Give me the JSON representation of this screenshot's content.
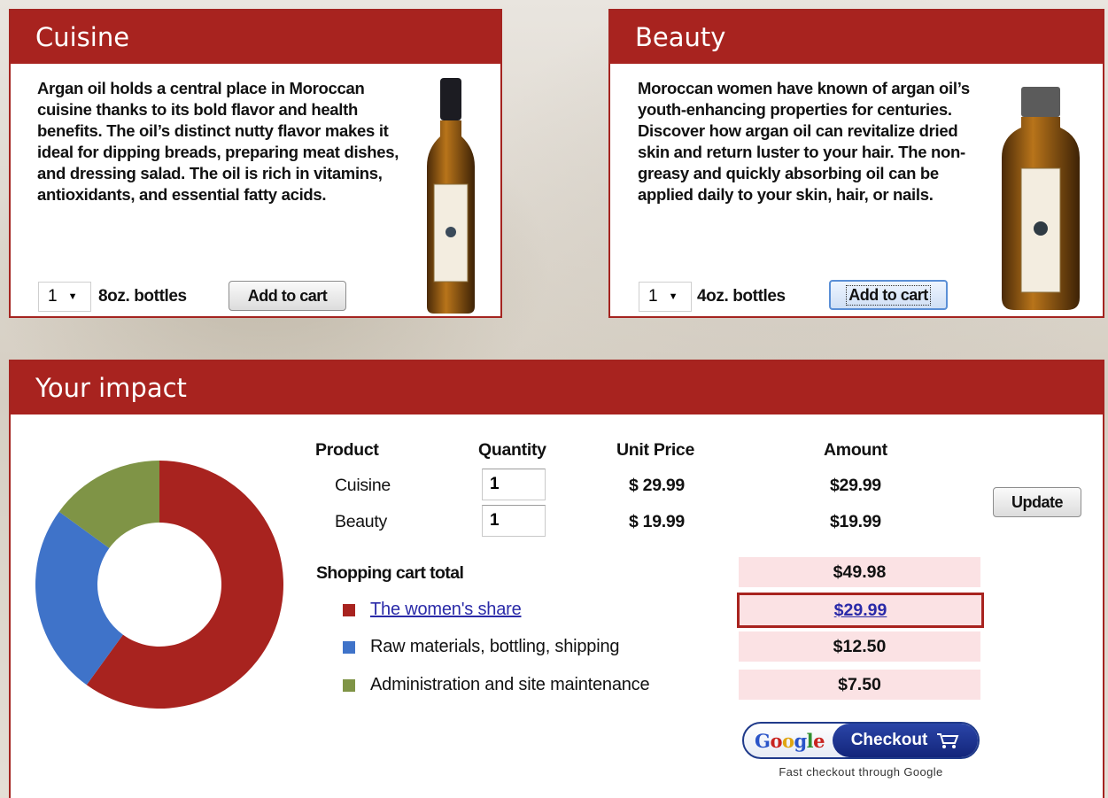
{
  "cuisine": {
    "title": "Cuisine",
    "description": "Argan oil holds a central place in Moroccan cuisine thanks to its bold flavor and health benefits. The oil’s distinct nutty flavor makes it ideal for dipping breads, preparing meat dishes, and dressing salad. The oil is rich in vitamins, antioxidants, and essential fatty acids.",
    "quantity": "1",
    "unit": "8oz. bottles",
    "add_label": "Add to cart"
  },
  "beauty": {
    "title": "Beauty",
    "description": "Moroccan women have known of argan oil’s youth-enhancing properties for centuries. Discover how argan oil can revitalize dried skin and return luster to your hair. The non-greasy and quickly absorbing oil can be applied daily to your skin, hair, or nails.",
    "quantity": "1",
    "unit": "4oz. bottles",
    "add_label": "Add to cart"
  },
  "impact": {
    "title": "Your impact",
    "headers": {
      "product": "Product",
      "quantity": "Quantity",
      "unit_price": "Unit Price",
      "amount": "Amount"
    },
    "rows": [
      {
        "product": "Cuisine",
        "quantity": "1",
        "unit_price": "$ 29.99",
        "amount": "$29.99"
      },
      {
        "product": "Beauty",
        "quantity": "1",
        "unit_price": "$ 19.99",
        "amount": "$19.99"
      }
    ],
    "update_label": "Update",
    "total_label": "Shopping cart total",
    "total_amount": "$49.98",
    "breakdown": [
      {
        "label": "The women's share",
        "amount": "$29.99",
        "color": "#a8231f"
      },
      {
        "label": "Raw materials, bottling, shipping",
        "amount": "$12.50",
        "color": "#3f73c9"
      },
      {
        "label": "Administration and site maintenance",
        "amount": "$7.50",
        "color": "#7f9446"
      }
    ],
    "checkout": {
      "google": "Google",
      "button": "Checkout",
      "caption": "Fast checkout through Google"
    }
  },
  "chart_data": {
    "type": "pie",
    "categories": [
      "The women's share",
      "Raw materials, bottling, shipping",
      "Administration and site maintenance"
    ],
    "values": [
      29.99,
      12.5,
      7.5
    ],
    "colors": [
      "#a8231f",
      "#3f73c9",
      "#7f9446"
    ]
  }
}
